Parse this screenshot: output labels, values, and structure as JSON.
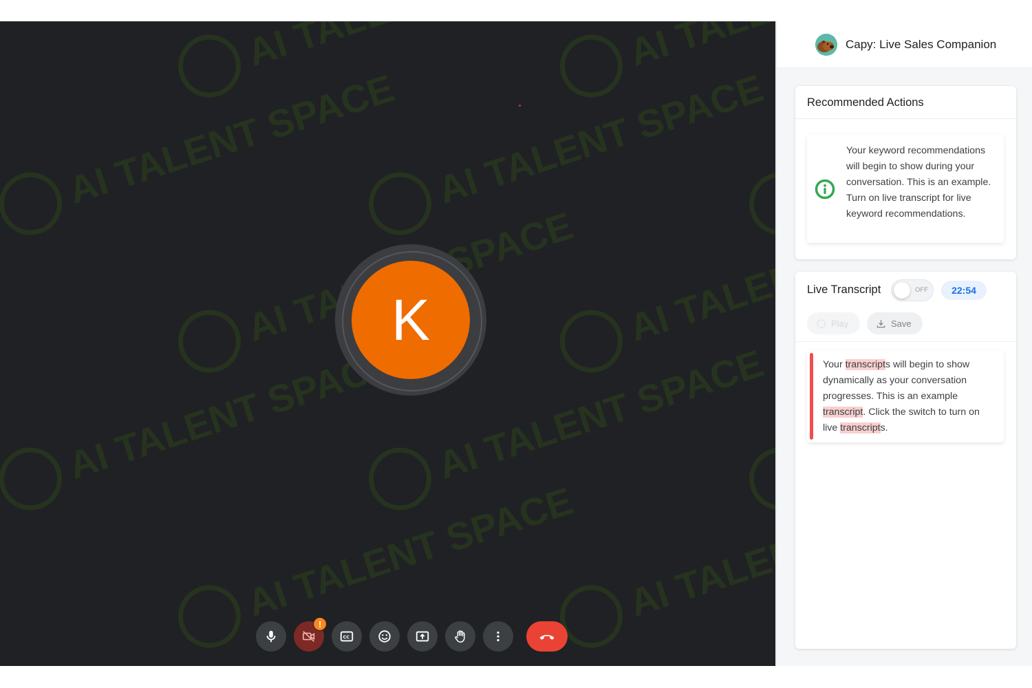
{
  "meeting": {
    "participant_initial": "K",
    "avatar_color": "#ef6c00",
    "watermark_text": "AI TALENT SPACE",
    "controls": [
      {
        "name": "microphone-button",
        "icon": "mic-icon"
      },
      {
        "name": "camera-button",
        "icon": "camera-off-icon",
        "badge": "!"
      },
      {
        "name": "captions-button",
        "icon": "closed-captions-icon"
      },
      {
        "name": "reactions-button",
        "icon": "emoji-icon"
      },
      {
        "name": "present-button",
        "icon": "present-screen-icon"
      },
      {
        "name": "raise-hand-button",
        "icon": "raise-hand-icon"
      },
      {
        "name": "more-options-button",
        "icon": "more-vertical-icon"
      },
      {
        "name": "end-call-button",
        "icon": "end-call-icon"
      }
    ],
    "end_call_color": "#ea4335"
  },
  "panel": {
    "title": "Capy: Live Sales Companion",
    "recommended": {
      "title": "Recommended Actions",
      "icon": "info-icon",
      "icon_color": "#34a853",
      "text": "Your keyword recommendations will begin to show during your conversation. This is an example. Turn on live transcript for live keyword recommendations."
    },
    "transcript": {
      "title": "Live Transcript",
      "toggle_state": "OFF",
      "timer": "22:54",
      "play_label": "Play",
      "save_label": "Save",
      "text_segments": [
        {
          "text": "Your ",
          "hl": false
        },
        {
          "text": "transcript",
          "hl": true
        },
        {
          "text": "s will begin to show dynamically as your conversation progresses. This is an example ",
          "hl": false
        },
        {
          "text": "transcript",
          "hl": true
        },
        {
          "text": ". Click the switch to turn on live ",
          "hl": false
        },
        {
          "text": "transcript",
          "hl": true
        },
        {
          "text": "s.",
          "hl": false
        }
      ],
      "accent_color": "#ef4e4e"
    }
  }
}
